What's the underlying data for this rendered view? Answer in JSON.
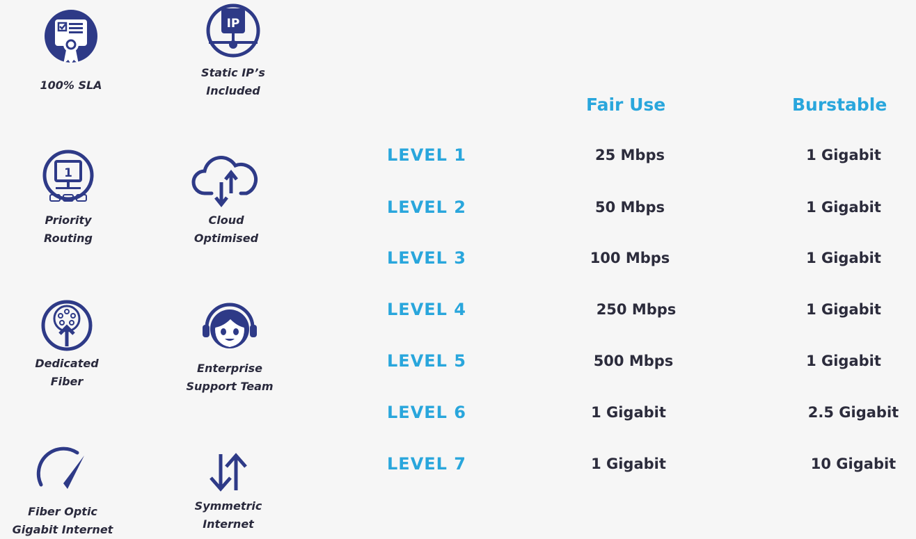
{
  "features": [
    {
      "icon": "sla-certificate-icon",
      "label_lines": [
        "100% SLA"
      ]
    },
    {
      "icon": "static-ip-icon",
      "label_lines": [
        "Static IP’s",
        "Included"
      ]
    },
    {
      "icon": "priority-routing-icon",
      "label_lines": [
        "Priority",
        "Routing"
      ]
    },
    {
      "icon": "cloud-sync-icon",
      "label_lines": [
        "Cloud",
        "Optimised"
      ]
    },
    {
      "icon": "dedicated-fiber-icon",
      "label_lines": [
        "Dedicated",
        "Fiber"
      ]
    },
    {
      "icon": "support-headset-icon",
      "label_lines": [
        "Enterprise",
        "Support Team"
      ]
    },
    {
      "icon": "speedometer-icon",
      "label_lines": [
        "Fiber Optic",
        "Gigabit Internet"
      ]
    },
    {
      "icon": "symmetric-arrows-icon",
      "label_lines": [
        "Symmetric",
        "Internet"
      ]
    }
  ],
  "table": {
    "headers": [
      "Fair Use",
      "Burstable"
    ],
    "rows": [
      {
        "level": "LEVEL 1",
        "fair_use": "25 Mbps",
        "burstable": "1 Gigabit"
      },
      {
        "level": "LEVEL 2",
        "fair_use": "50 Mbps",
        "burstable": "1 Gigabit"
      },
      {
        "level": "LEVEL 3",
        "fair_use": "100 Mbps",
        "burstable": "1 Gigabit"
      },
      {
        "level": "LEVEL 4",
        "fair_use": "250 Mbps",
        "burstable": "1 Gigabit"
      },
      {
        "level": "LEVEL 5",
        "fair_use": "500 Mbps",
        "burstable": "1 Gigabit"
      },
      {
        "level": "LEVEL 6",
        "fair_use": "1 Gigabit",
        "burstable": "2.5 Gigabit"
      },
      {
        "level": "LEVEL 7",
        "fair_use": "1 Gigabit",
        "burstable": "10 Gigabit"
      }
    ]
  },
  "colors": {
    "icon": "#2e3a87",
    "accent": "#29a6dc",
    "text": "#2c2c3c"
  }
}
